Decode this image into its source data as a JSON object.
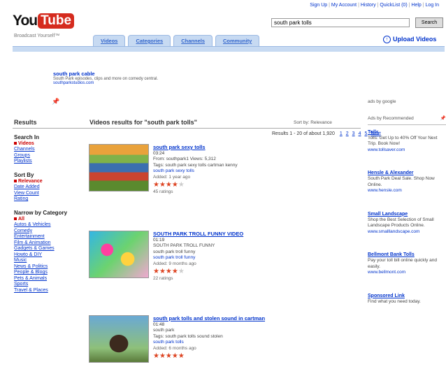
{
  "header": {
    "logo_you": "You",
    "logo_tube": "Tube",
    "tagline": "Broadcast Yourself™",
    "top_links": [
      "Sign Up",
      "My Account",
      "History",
      "QuickList (0)",
      "Help",
      "Log In"
    ],
    "search_value": "south park tolls",
    "search_button": "Search",
    "upload_label": "Upload Videos",
    "tabs": [
      "Videos",
      "Categories",
      "Channels",
      "Community"
    ]
  },
  "promo": {
    "title": "south park cable",
    "description": "South Park episodes, clips and more on comedy central.",
    "url": "southparkstudios.com"
  },
  "results": {
    "left_heading": "Results",
    "videos_prefix": "Videos results for",
    "query": "\"south park tolls\"",
    "sort_label": "Sort by: Relevance",
    "pager_label": "Results 1 - 20 of about 1,920",
    "pages": [
      "1",
      "2",
      "3",
      "4",
      "5",
      "Next"
    ]
  },
  "sidebar": {
    "sections": [
      {
        "heading": "Search In",
        "selected": "Videos",
        "items": [
          "Channels",
          "Groups",
          "Playlists"
        ]
      },
      {
        "heading": "Sort By",
        "selected": "Relevance",
        "items": [
          "Date Added",
          "View Count",
          "Rating"
        ]
      },
      {
        "heading": "Narrow by Category",
        "selected": "All",
        "items": [
          "Autos & Vehicles",
          "Comedy",
          "Entertainment",
          "Film & Animation",
          "Gadgets & Games",
          "Howto & DIY",
          "Music",
          "News & Politics",
          "People & Blogs",
          "Pets & Animals",
          "Sports",
          "Travel & Places"
        ]
      }
    ]
  },
  "videos": [
    {
      "title": "south park sexy tolls",
      "time": "03:24",
      "description": "From: southpark1 Views: 5,312",
      "desc2": "Tags: south park sexy tolls cartman kenny",
      "tags": "south park sexy tolls",
      "meta": "Added: 1 year ago",
      "rating_count": "45 ratings",
      "stars": 4
    },
    {
      "title": "SOUTH PARK TROLL FUNNY VIDEO",
      "time": "01:19",
      "description": "SOUTH PARK TROLL FUNNY",
      "desc2": "south park troll funny",
      "tags": "south park troll funny",
      "meta": "Added: 9 months ago",
      "rating_count": "22 ratings",
      "stars": 4
    },
    {
      "title": "south park tolls and stolen sound in cartman",
      "time": "01:48",
      "description": "south park",
      "desc2": "Tags: south park tolls sound stolen",
      "tags": "south park tolls",
      "meta": "Added: 6 months ago",
      "rating_count": "14 ratings",
      "stars": 5
    }
  ],
  "right": {
    "label1": "ads by google",
    "label2": "Ads by Recommended",
    "entries": [
      {
        "name": "Tolls",
        "text": "Tolls: Get Up to 40% Off Your Next Trip. Book Now!",
        "url": "www.tollsaver.com"
      },
      {
        "name": "Hensle & Alexander",
        "text": "South Park Deal Sale. Shop Now Online.",
        "url": "www.hensle.com"
      },
      {
        "name": "Small Landscape",
        "text": "Shop the Best Selection of Small Landscape Products Online.",
        "url": "www.smalllandscape.com"
      },
      {
        "name": "Bellmont Bank Tolls",
        "text": "Pay your toll bill online quickly and easily.",
        "url": "www.bellmont.com"
      },
      {
        "name": "Sponsored Link",
        "text": "Find what you need today.",
        "url": "www.sponsored.com"
      }
    ]
  },
  "colors": {
    "accent": "#0033cc",
    "brand_red": "#d52b1e",
    "tab_bg": "#c7daf2"
  }
}
